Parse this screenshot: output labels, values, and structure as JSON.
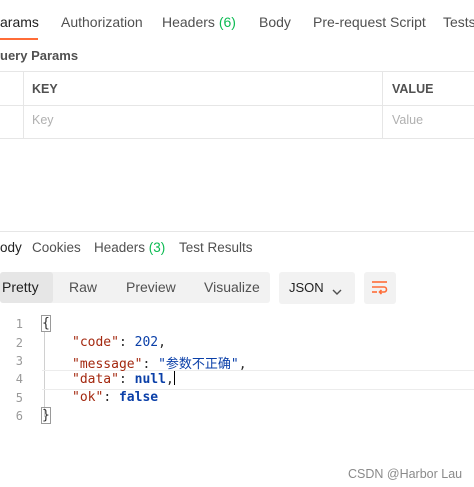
{
  "request_tabs": [
    {
      "label": "arams"
    },
    {
      "label": "Authorization"
    },
    {
      "label": "Headers",
      "count": "(6)"
    },
    {
      "label": "Body"
    },
    {
      "label": "Pre-request Script"
    },
    {
      "label": "Tests"
    }
  ],
  "query_params": {
    "title": "uery Params",
    "headers": {
      "key": "KEY",
      "value": "VALUE"
    },
    "placeholders": {
      "key": "Key",
      "value": "Value"
    }
  },
  "response_tabs": [
    {
      "label": "ody"
    },
    {
      "label": "Cookies"
    },
    {
      "label": "Headers",
      "count": "(3)"
    },
    {
      "label": "Test Results"
    }
  ],
  "view_modes": {
    "pretty": "Pretty",
    "raw": "Raw",
    "preview": "Preview",
    "visualize": "Visualize"
  },
  "format_select": {
    "value": "JSON"
  },
  "icons": {
    "chevron": "chevron-down-icon",
    "wrap": "text-wrap-icon"
  },
  "colors": {
    "accent": "#ff6c37",
    "count": "#0cbb52",
    "json_key": "#a3280f",
    "json_value": "#0a3fa8"
  },
  "code_lines": [
    {
      "number": "1",
      "open": "{"
    },
    {
      "number": "2",
      "key": "\"code\"",
      "value": "202",
      "comma": ","
    },
    {
      "number": "3",
      "key": "\"message\"",
      "value": "\"参数不正确\"",
      "comma": ","
    },
    {
      "number": "4",
      "key": "\"data\"",
      "value": "null",
      "comma": ","
    },
    {
      "number": "5",
      "key": "\"ok\"",
      "value": "false",
      "comma": ""
    },
    {
      "number": "6",
      "close": "}"
    }
  ],
  "watermark": "CSDN @Harbor Lau"
}
